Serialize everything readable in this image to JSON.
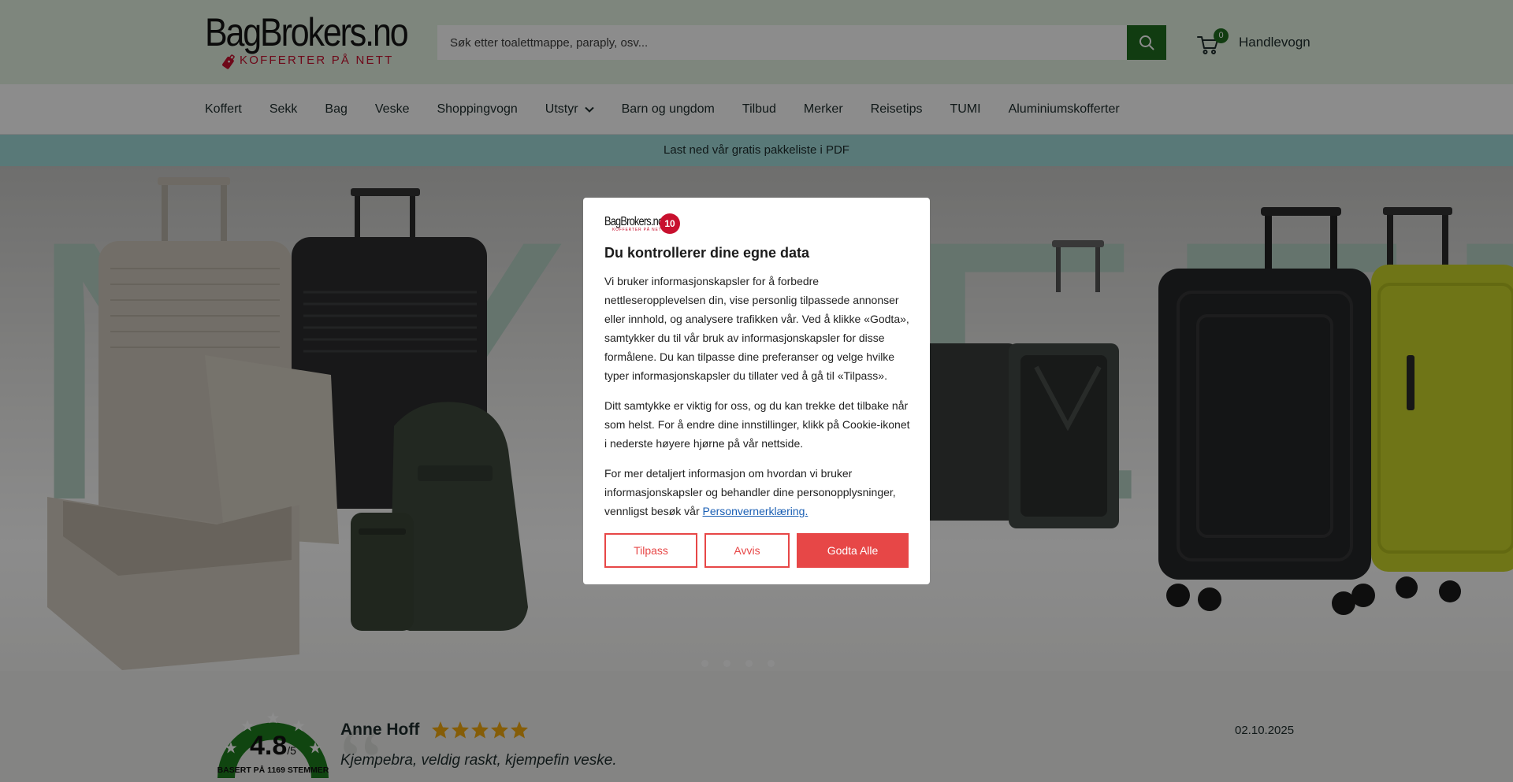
{
  "header": {
    "logo_main": "BagBrokers.no",
    "logo_sub": "KOFFERTER PÅ NETT",
    "search_placeholder": "Søk etter toalettmappe, paraply, osv...",
    "cart_count": "0",
    "cart_label": "Handlevogn",
    "brand_color": "#1f6e1f",
    "header_bg": "#e6f4e3"
  },
  "nav": {
    "items": [
      "Koffert",
      "Sekk",
      "Bag",
      "Veske",
      "Shoppingvogn",
      "Utstyr",
      "Barn og ungdom",
      "Tilbud",
      "Merker",
      "Reisetips",
      "TUMI",
      "Aluminiumskofferter"
    ]
  },
  "announcement": {
    "text": "Last ned vår gratis pakkeliste i PDF",
    "bg": "#a3dcdb"
  },
  "hero": {
    "bg_text": "NYHETER",
    "slide_count": 4
  },
  "reviews": {
    "score": "4.8",
    "score_suffix": "/5",
    "based_on": "BASERT PÅ 1169 STEMMER",
    "reviewer": "Anne Hoff",
    "rating": 5,
    "date": "02.10.2025",
    "text": "Kjempebra,  veldig raskt, kjempefin veske.",
    "star_color": "#f2a90f"
  },
  "cookie_modal": {
    "logo_text": "BagBrokers.no",
    "logo_sub": "KOFFERTER PÅ NETT",
    "logo_badge": "10",
    "title": "Du kontrollerer dine egne data",
    "paragraph1": "Vi bruker informasjonskapsler for å forbedre nettleseropplevelsen din, vise personlig tilpassede annonser eller innhold, og analysere trafikken vår. Ved å klikke «Godta», samtykker du til vår bruk av informasjonskapsler for disse formålene. Du kan tilpasse dine preferanser og velge hvilke typer informasjonskapsler du tillater ved å gå til «Tilpass».",
    "paragraph2": "Ditt samtykke er viktig for oss, og du kan trekke det tilbake når som helst. For å endre dine innstillinger, klikk på Cookie-ikonet i nederste høyere hjørne på vår nettside.",
    "paragraph3_prefix": "For mer detaljert informasjon om hvordan vi bruker informasjonskapsler og behandler dine personopplysninger, vennligst besøk vår ",
    "privacy_link": "Personvernerklæring.",
    "btn_customize": "Tilpass",
    "btn_reject": "Avvis",
    "btn_accept": "Godta Alle",
    "accent": "#e74747"
  }
}
